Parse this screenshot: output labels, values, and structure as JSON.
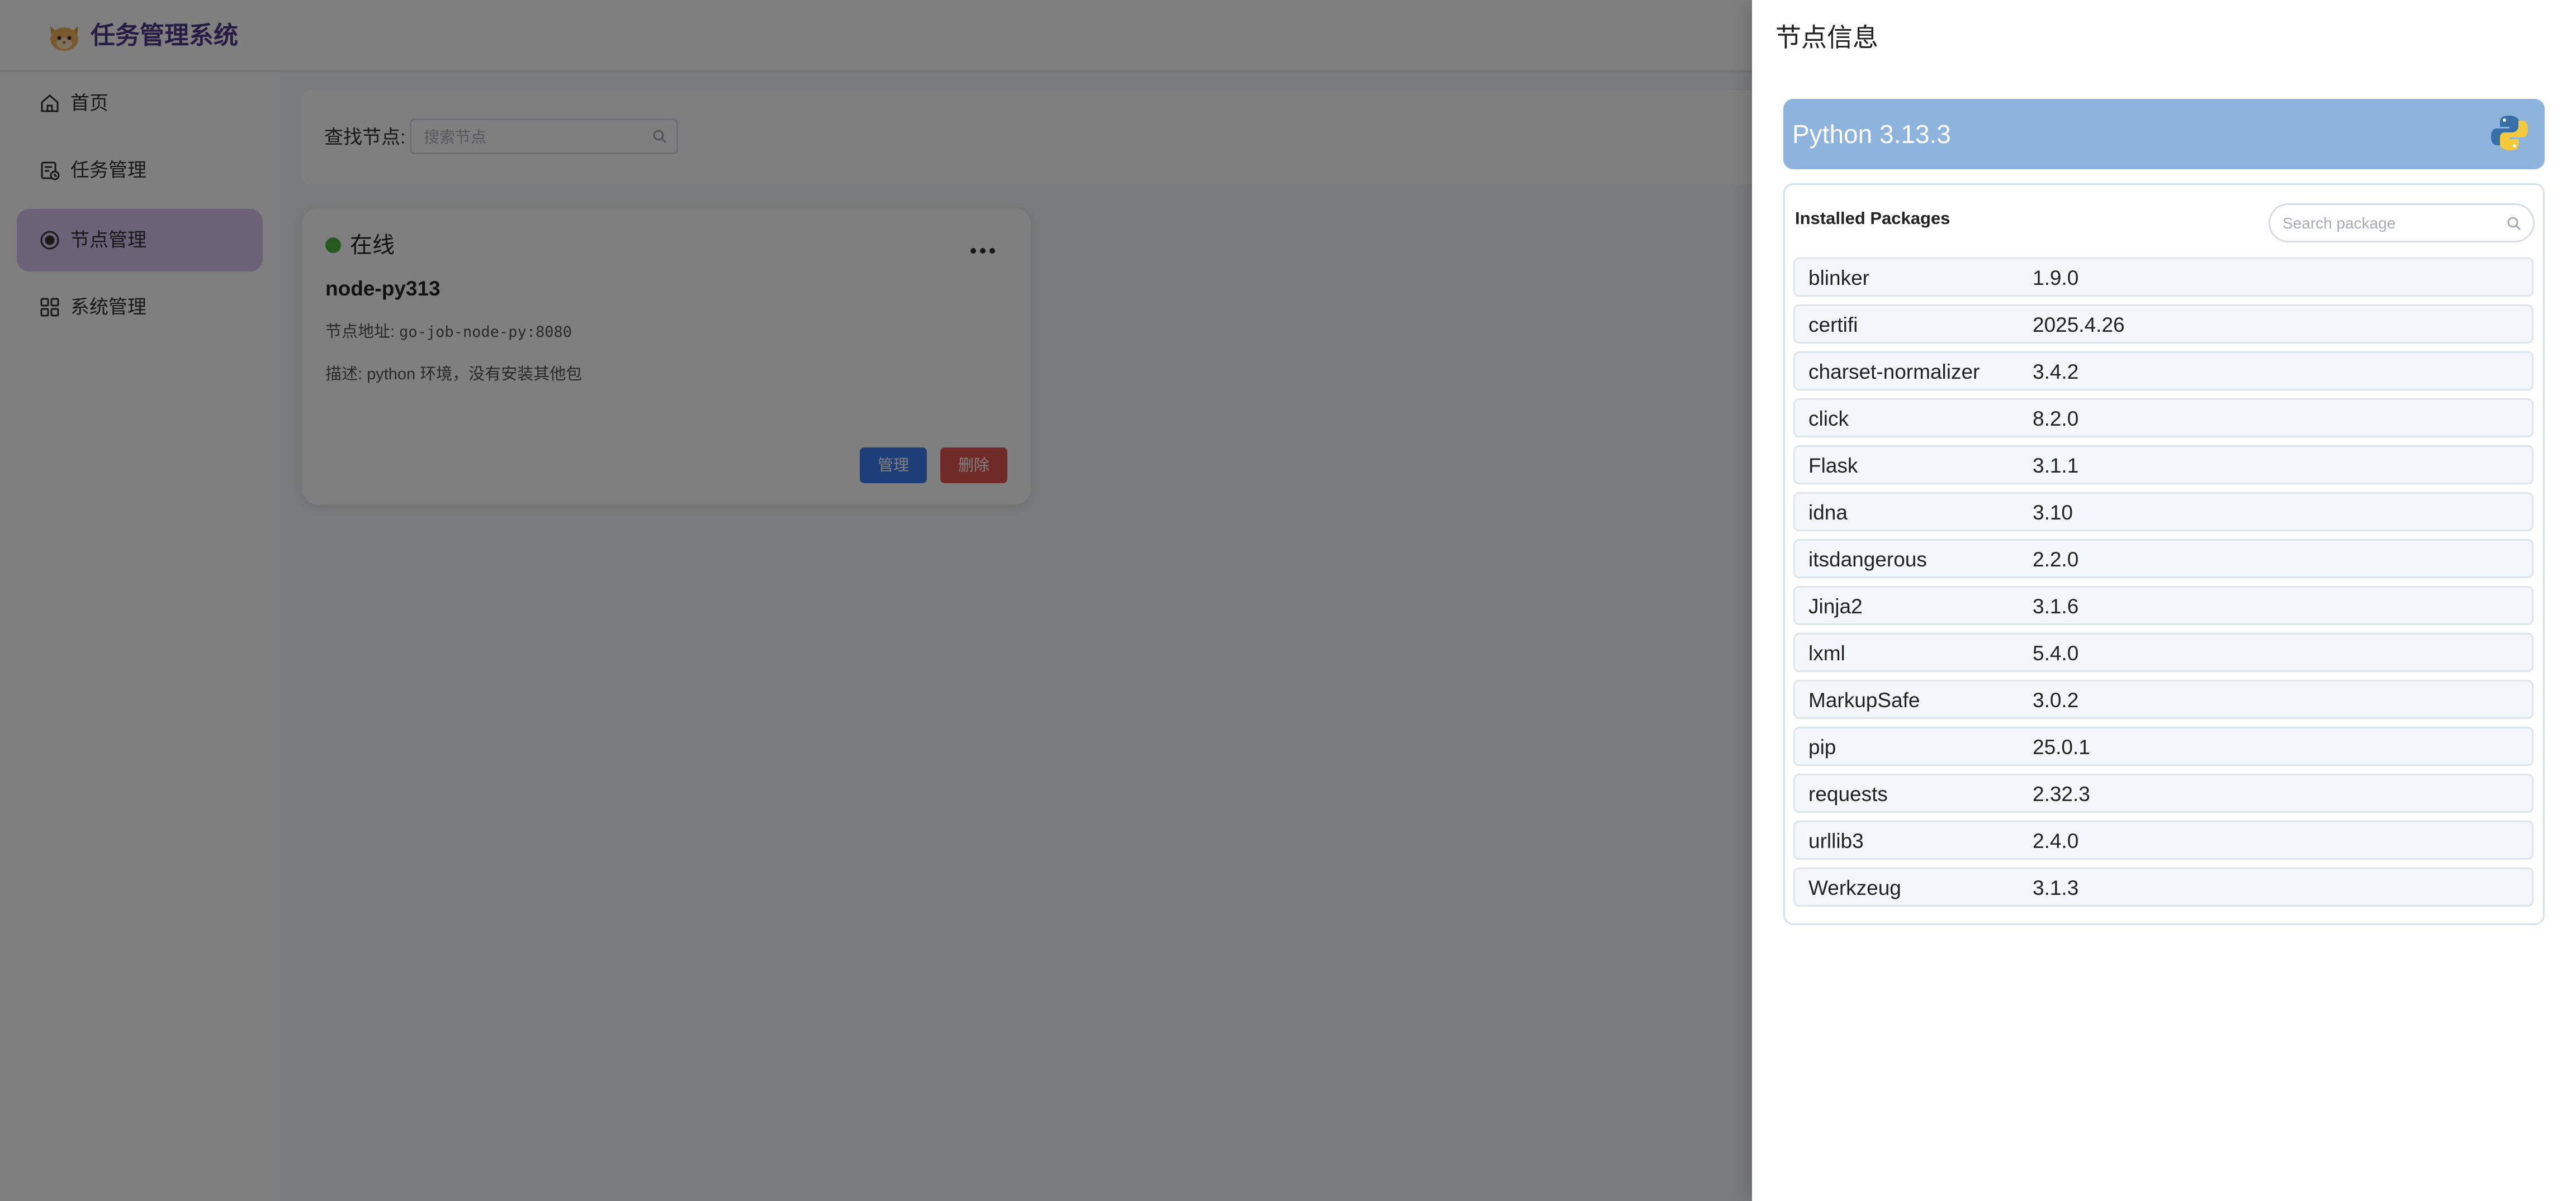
{
  "app": {
    "title": "任务管理系统"
  },
  "sidebar": {
    "items": [
      {
        "label": "首页",
        "icon": "home-icon",
        "active": false
      },
      {
        "label": "任务管理",
        "icon": "task-icon",
        "active": false
      },
      {
        "label": "节点管理",
        "icon": "node-icon",
        "active": true
      },
      {
        "label": "系统管理",
        "icon": "grid-icon",
        "active": false
      }
    ]
  },
  "search": {
    "label": "查找节点:",
    "placeholder": "搜索节点"
  },
  "node_card": {
    "status": "在线",
    "status_color": "#49b53a",
    "name": "node-py313",
    "address_label": "节点地址: ",
    "address": "go-job-node-py:8080",
    "description": "描述: python 环境，没有安装其他包",
    "manage_label": "管理",
    "delete_label": "删除"
  },
  "drawer": {
    "title": "节点信息",
    "python_version": "Python 3.13.3",
    "packages_heading": "Installed Packages",
    "package_search_placeholder": "Search package",
    "packages": [
      {
        "name": "blinker",
        "version": "1.9.0"
      },
      {
        "name": "certifi",
        "version": "2025.4.26"
      },
      {
        "name": "charset-normalizer",
        "version": "3.4.2"
      },
      {
        "name": "click",
        "version": "8.2.0"
      },
      {
        "name": "Flask",
        "version": "3.1.1"
      },
      {
        "name": "idna",
        "version": "3.10"
      },
      {
        "name": "itsdangerous",
        "version": "2.2.0"
      },
      {
        "name": "Jinja2",
        "version": "3.1.6"
      },
      {
        "name": "lxml",
        "version": "5.4.0"
      },
      {
        "name": "MarkupSafe",
        "version": "3.0.2"
      },
      {
        "name": "pip",
        "version": "25.0.1"
      },
      {
        "name": "requests",
        "version": "2.32.3"
      },
      {
        "name": "urllib3",
        "version": "2.4.0"
      },
      {
        "name": "Werkzeug",
        "version": "3.1.3"
      }
    ]
  },
  "colors": {
    "accent": "#4a3b86",
    "active_nav": "#d7c4ee",
    "manage_button": "#3c7df0",
    "delete_button": "#e0554f",
    "python_header": "#8eb3dd"
  }
}
